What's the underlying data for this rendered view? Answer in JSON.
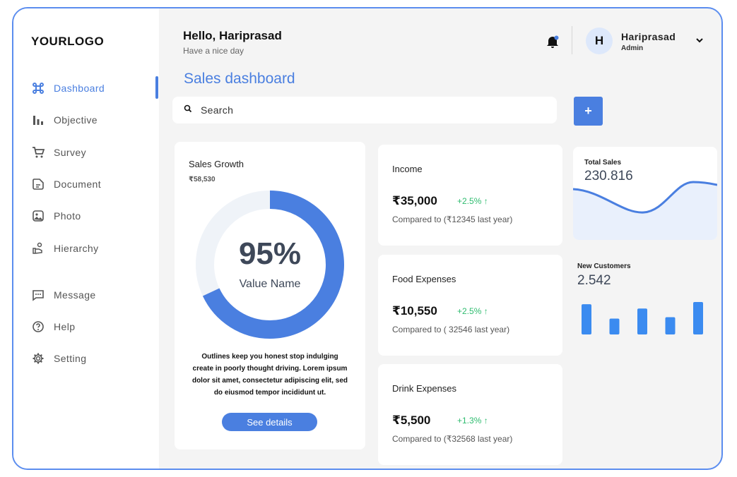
{
  "brand": {
    "logo": "YOURLOGO",
    "accent": "#4a7fe0"
  },
  "sidebar": {
    "items": [
      {
        "label": "Dashboard",
        "icon": "command-icon",
        "active": true
      },
      {
        "label": "Objective",
        "icon": "bar-chart-icon"
      },
      {
        "label": "Survey",
        "icon": "cart-icon"
      },
      {
        "label": "Document",
        "icon": "document-icon"
      },
      {
        "label": "Photo",
        "icon": "photo-icon"
      },
      {
        "label": "Hierarchy",
        "icon": "hierarchy-icon"
      },
      {
        "label": "Message",
        "icon": "message-icon"
      },
      {
        "label": "Help",
        "icon": "help-icon"
      },
      {
        "label": "Setting",
        "icon": "gear-icon"
      }
    ]
  },
  "header": {
    "greeting": "Hello, Hariprasad",
    "subtitle": "Have a nice day",
    "user": {
      "initial": "H",
      "name": "Hariprasad",
      "role": "Admin"
    }
  },
  "main": {
    "title": "Sales dashboard",
    "search": {
      "placeholder": "Search",
      "value": ""
    },
    "add_label": "+"
  },
  "sales_growth": {
    "title": "Sales Growth",
    "value": "₹58,530",
    "percent_label": "95%",
    "percent_value": 0.68,
    "value_name": "Value Name",
    "description": "Outlines keep you honest stop indulging create in poorly thought driving. Lorem ipsum dolor sit amet, consectetur adipiscing elit, sed do eiusmod tempor incididunt ut.",
    "button": "See details"
  },
  "expenses": [
    {
      "title": "Income",
      "amount": "₹35,000",
      "change": "+2.5% ↑",
      "compare": "Compared to (₹12345 last year)"
    },
    {
      "title": "Food Expenses",
      "amount": "₹10,550",
      "change": "+2.5% ↑",
      "compare": "Compared to (  32546 last year)"
    },
    {
      "title": "Drink Expenses",
      "amount": "₹5,500",
      "change": "+1.3% ↑",
      "compare": "Compared to (₹32568 last year)"
    }
  ],
  "total_sales": {
    "title": "Total Sales",
    "value": "230.816"
  },
  "new_customers": {
    "title": "New Customers",
    "value": "2.542",
    "bars": [
      42,
      22,
      36,
      24,
      45
    ]
  }
}
